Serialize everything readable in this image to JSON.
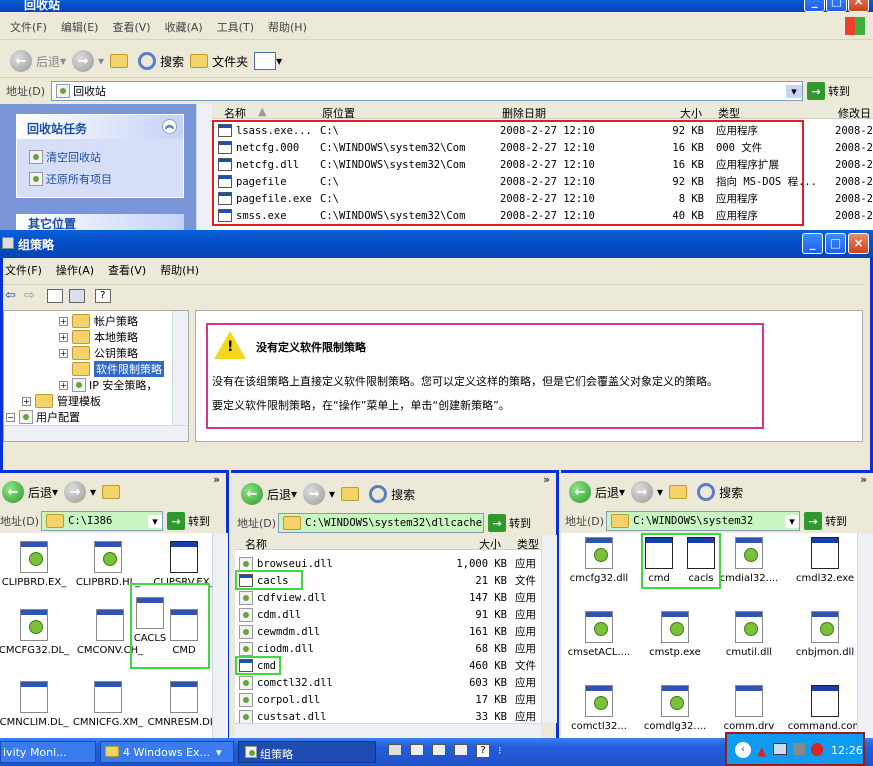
{
  "recycle": {
    "title": "回收站",
    "menu": [
      "文件(F)",
      "编辑(E)",
      "查看(V)",
      "收藏(A)",
      "工具(T)",
      "帮助(H)"
    ],
    "toolbar": {
      "back": "后退",
      "search": "搜索",
      "folders": "文件夹"
    },
    "address_label": "地址(D)",
    "address_value": "回收站",
    "go_label": "转到",
    "tasks_title": "回收站任务",
    "task_empty": "清空回收站",
    "task_restore": "还原所有项目",
    "other_places": "其它位置",
    "columns": [
      "名称",
      "原位置",
      "删除日期",
      "大小",
      "类型",
      "修改日"
    ],
    "rows": [
      {
        "name": "lsass.exe...",
        "location": "C:\\",
        "date": "2008-2-27 12:10",
        "size": "92 KB",
        "type": "应用程序",
        "mod": "2008-2"
      },
      {
        "name": "netcfg.000",
        "location": "C:\\WINDOWS\\system32\\Com",
        "date": "2008-2-27 12:10",
        "size": "16 KB",
        "type": "000 文件",
        "mod": "2008-2"
      },
      {
        "name": "netcfg.dll",
        "location": "C:\\WINDOWS\\system32\\Com",
        "date": "2008-2-27 12:10",
        "size": "16 KB",
        "type": "应用程序扩展",
        "mod": "2008-2"
      },
      {
        "name": "pagefile",
        "location": "C:\\",
        "date": "2008-2-27 12:10",
        "size": "92 KB",
        "type": "指向 MS-DOS 程...",
        "mod": "2008-2"
      },
      {
        "name": "pagefile.exe",
        "location": "C:\\",
        "date": "2008-2-27 12:10",
        "size": "8 KB",
        "type": "应用程序",
        "mod": "2008-2"
      },
      {
        "name": "smss.exe",
        "location": "C:\\WINDOWS\\system32\\Com",
        "date": "2008-2-27 12:10",
        "size": "40 KB",
        "type": "应用程序",
        "mod": "2008-2"
      }
    ]
  },
  "gp": {
    "title": "组策略",
    "menu": [
      "文件(F)",
      "操作(A)",
      "查看(V)",
      "帮助(H)"
    ],
    "tree": [
      "帐户策略",
      "本地策略",
      "公钥策略",
      "软件限制策略",
      "IP 安全策略，",
      "管理模板",
      "用户配置"
    ],
    "heading": "没有定义软件限制策略",
    "line1": "没有在该组策略上直接定义软件限制策略。您可以定义这样的策略，但是它们会覆盖父对象定义的策略。",
    "line2": "要定义软件限制策略，在“操作”菜单上，单击“创建新策略”。"
  },
  "pane1": {
    "back": "后退",
    "address_label": "地址(D)",
    "address": "C:\\I386",
    "go": "转到",
    "icons": [
      "CLIPBRD.EX_",
      "CLIPBRD.HL_",
      "CLIPSRV.EX_",
      "CMCFG32.DL_",
      "CMCONV.CH_",
      "CACLS",
      "CMD",
      "CMNCLIM.DL_",
      "CMNICFG.XM_",
      "CMNRESM.DL_"
    ]
  },
  "pane2": {
    "back": "后退",
    "search": "搜索",
    "address_label": "地址(D)",
    "address": "C:\\WINDOWS\\system32\\dllcache",
    "go": "转到",
    "columns": [
      "名称",
      "大小",
      "类型"
    ],
    "rows": [
      {
        "name": "browseui.dll",
        "size": "1,000 KB",
        "type": "应用"
      },
      {
        "name": "cacls",
        "size": "21 KB",
        "type": "文件"
      },
      {
        "name": "cdfview.dll",
        "size": "147 KB",
        "type": "应用"
      },
      {
        "name": "cdm.dll",
        "size": "91 KB",
        "type": "应用"
      },
      {
        "name": "cewmdm.dll",
        "size": "161 KB",
        "type": "应用"
      },
      {
        "name": "ciodm.dll",
        "size": "68 KB",
        "type": "应用"
      },
      {
        "name": "cmd",
        "size": "460 KB",
        "type": "文件"
      },
      {
        "name": "comctl32.dll",
        "size": "603 KB",
        "type": "应用"
      },
      {
        "name": "corpol.dll",
        "size": "17 KB",
        "type": "应用"
      },
      {
        "name": "custsat.dll",
        "size": "33 KB",
        "type": "应用"
      }
    ]
  },
  "pane3": {
    "back": "后退",
    "search": "搜索",
    "address_label": "地址(D)",
    "address": "C:\\WINDOWS\\system32",
    "go": "转到",
    "icons": [
      "cmcfg32.dll",
      "cmd",
      "cacls",
      "cmdial32....",
      "cmdl32.exe",
      "cmsetACL....",
      "cmstp.exe",
      "cmutil.dll",
      "cnbjmon.dll",
      "comctl32...",
      "comdlg32....",
      "comm.drv",
      "command.com"
    ]
  },
  "taskbar": {
    "item1": "ivity Moni...",
    "item2": "4 Windows Ex...",
    "item3": "组策略",
    "clock": "12:26"
  }
}
